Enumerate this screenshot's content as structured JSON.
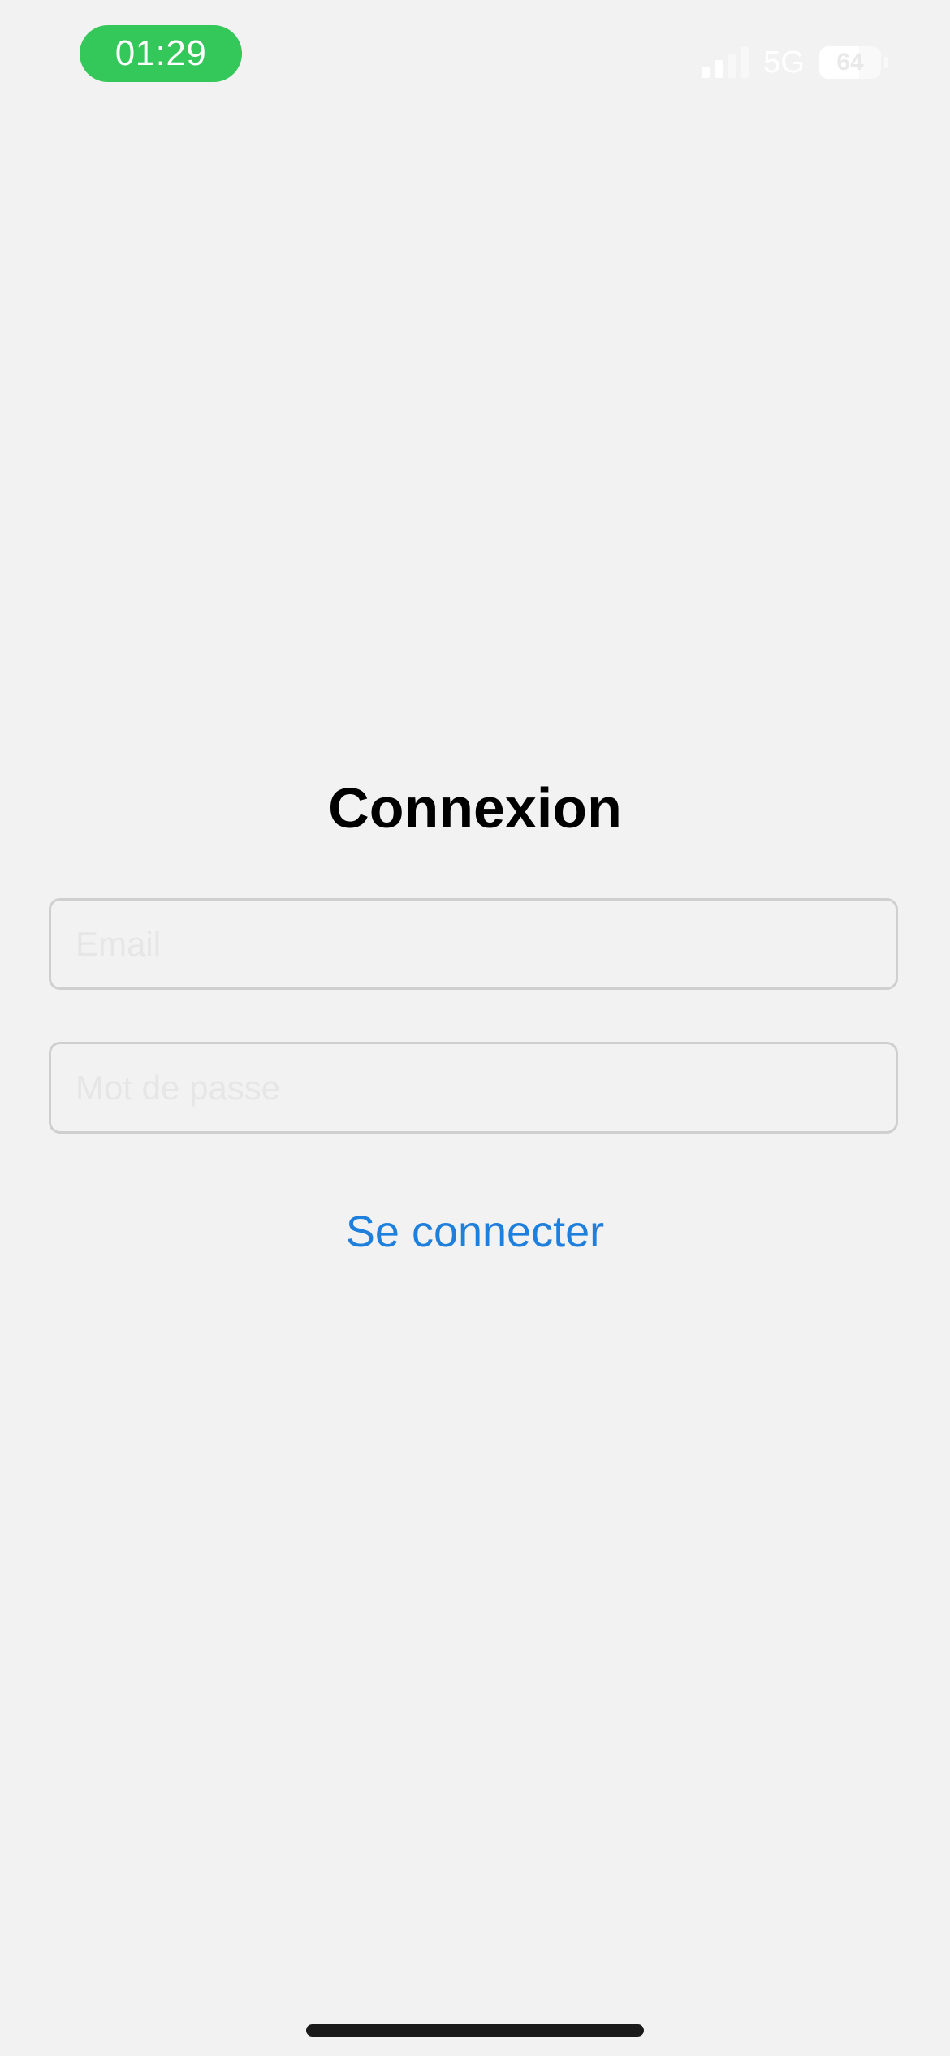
{
  "status_bar": {
    "time": "01:29",
    "time_pill_color": "#34c759",
    "network": "5G",
    "battery_level": "64",
    "battery_fraction": 0.64,
    "signal_bars": 4,
    "signal_active_bars": 2,
    "icons": [
      "cellular-signal-icon",
      "battery-icon"
    ]
  },
  "login": {
    "title": "Connexion",
    "email_placeholder": "Email",
    "password_placeholder": "Mot de passe",
    "submit_label": "Se connecter"
  },
  "colors": {
    "background": "#f2f2f2",
    "accent": "#1e7fdc",
    "field_border": "#cfcfcf"
  }
}
